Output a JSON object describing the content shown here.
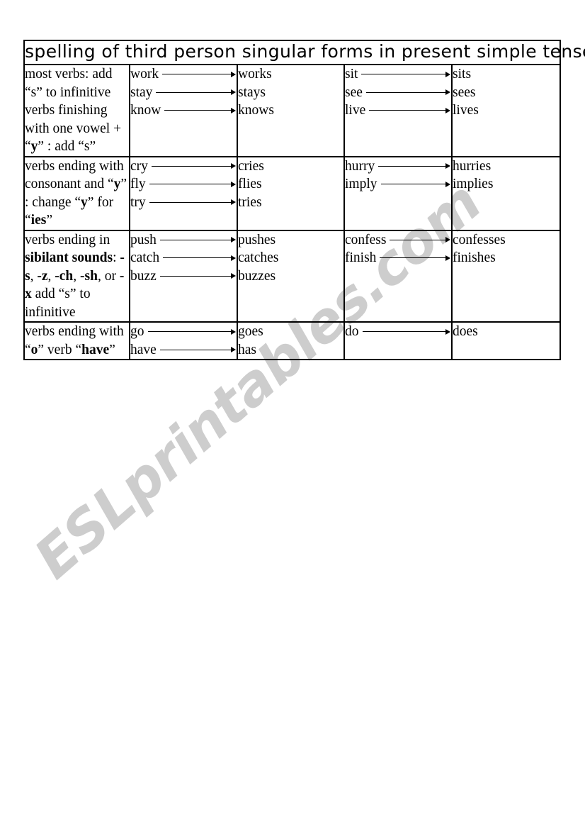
{
  "title": "spelling of third person singular forms in present simple tense",
  "watermark": "ESLprintables.com",
  "colors": {
    "stem": "#000000",
    "sibilant": "#3d8fb5",
    "ending": "#b02030",
    "border": "#000000",
    "watermark": "#cdcdcd"
  },
  "rows": [
    {
      "rule_html": "most verbs: add “s” to infinitive verbs finishing with one vowel + “<b>y</b>” : add “s”",
      "rule_plain": "most verbs: add “s” to infinitive verbs finishing with one vowel + “y” : add “s”",
      "group_a": {
        "verbs": [
          "work",
          "stay",
          "know"
        ],
        "results": [
          [
            {
              "t": "work",
              "c": "stem"
            },
            {
              "t": "s",
              "c": "ending"
            }
          ],
          [
            {
              "t": "stay",
              "c": "stem"
            },
            {
              "t": "s",
              "c": "ending"
            }
          ],
          [
            {
              "t": "know",
              "c": "stem"
            },
            {
              "t": "s",
              "c": "ending"
            }
          ]
        ]
      },
      "group_b": {
        "verbs": [
          "sit",
          "see",
          "live"
        ],
        "results": [
          [
            {
              "t": "sit",
              "c": "stem"
            },
            {
              "t": "s",
              "c": "ending"
            }
          ],
          [
            {
              "t": "see",
              "c": "stem"
            },
            {
              "t": "s",
              "c": "ending"
            }
          ],
          [
            {
              "t": "live",
              "c": "stem"
            },
            {
              "t": "s",
              "c": "ending"
            }
          ]
        ]
      }
    },
    {
      "rule_html": "verbs ending with consonant and “<b>y</b>” : change “<b>y</b>” for “<b>ies</b>”",
      "rule_plain": "verbs ending with consonant and “y” : change “y” for “ies”",
      "group_a": {
        "verbs": [
          "cry",
          "fly",
          "try"
        ],
        "results": [
          [
            {
              "t": "cr",
              "c": "stem"
            },
            {
              "t": "ies",
              "c": "ending"
            }
          ],
          [
            {
              "t": "fl",
              "c": "stem"
            },
            {
              "t": "ies",
              "c": "ending"
            }
          ],
          [
            {
              "t": "tr",
              "c": "stem"
            },
            {
              "t": "ies",
              "c": "ending"
            }
          ]
        ]
      },
      "group_b": {
        "verbs": [
          "hurry",
          "imply"
        ],
        "results": [
          [
            {
              "t": "hurr",
              "c": "stem"
            },
            {
              "t": "ies",
              "c": "ending"
            }
          ],
          [
            {
              "t": "impl",
              "c": "stem"
            },
            {
              "t": "ies",
              "c": "ending"
            }
          ]
        ]
      }
    },
    {
      "rule_html": "verbs ending in <b>sibilant sounds</b>: <b>-s</b>, <b>-z</b>, <b>-ch</b>, <b>-sh</b>, or <b>-x</b> add “s” to infinitive",
      "rule_plain": "verbs ending in sibilant sounds: -s, -z, -ch, -sh, or -x add “s” to infinitive",
      "group_a": {
        "verbs": [
          "push",
          "catch",
          "buzz"
        ],
        "results": [
          [
            {
              "t": "pu",
              "c": "stem"
            },
            {
              "t": "sh",
              "c": "sibilant"
            },
            {
              "t": "es",
              "c": "ending"
            }
          ],
          [
            {
              "t": "cat",
              "c": "stem"
            },
            {
              "t": "ch",
              "c": "sibilant"
            },
            {
              "t": "es",
              "c": "ending"
            }
          ],
          [
            {
              "t": "buz",
              "c": "stem"
            },
            {
              "t": "z",
              "c": "sibilant"
            },
            {
              "t": "es",
              "c": "ending"
            }
          ]
        ]
      },
      "group_b": {
        "verbs": [
          "confess",
          "finish"
        ],
        "results": [
          [
            {
              "t": "confes",
              "c": "stem"
            },
            {
              "t": "s",
              "c": "sibilant"
            },
            {
              "t": "es",
              "c": "ending"
            }
          ],
          [
            {
              "t": "fini",
              "c": "stem"
            },
            {
              "t": "sh",
              "c": "sibilant"
            },
            {
              "t": "es",
              "c": "ending"
            }
          ]
        ]
      }
    },
    {
      "rule_html": "verbs ending with “<b>o</b>” verb “<b>have</b>”",
      "rule_plain": "verbs ending with “o” verb “have”",
      "group_a": {
        "verbs": [
          "go",
          "have"
        ],
        "results": [
          [
            {
              "t": "go",
              "c": "stem"
            },
            {
              "t": "es",
              "c": "ending"
            }
          ],
          [
            {
              "t": "has",
              "c": "ending"
            }
          ]
        ]
      },
      "group_b": {
        "verbs": [
          "do"
        ],
        "results": [
          [
            {
              "t": "do",
              "c": "stem"
            },
            {
              "t": "es",
              "c": "ending"
            }
          ]
        ]
      }
    }
  ]
}
